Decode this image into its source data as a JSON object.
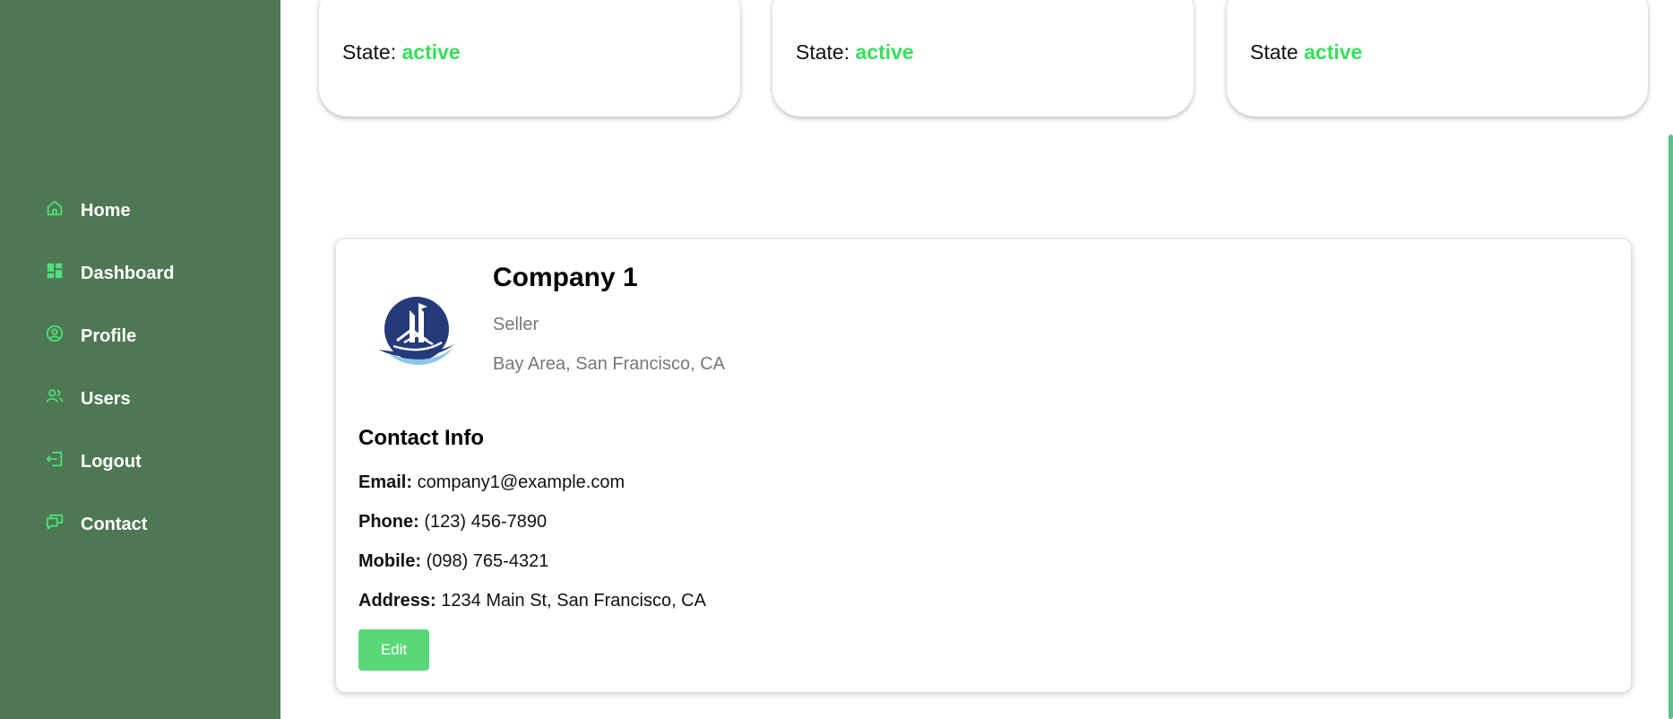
{
  "sidebar": {
    "items": [
      {
        "label": "Home",
        "icon": "home-icon"
      },
      {
        "label": "Dashboard",
        "icon": "dashboard-icon"
      },
      {
        "label": "Profile",
        "icon": "profile-icon"
      },
      {
        "label": "Users",
        "icon": "users-icon"
      },
      {
        "label": "Logout",
        "icon": "logout-icon"
      },
      {
        "label": "Contact",
        "icon": "contact-icon"
      }
    ]
  },
  "state_cards": [
    {
      "label": "State:",
      "value": "active"
    },
    {
      "label": "State:",
      "value": "active"
    },
    {
      "label": "State",
      "value": "active"
    }
  ],
  "company": {
    "name": "Company 1",
    "role": "Seller",
    "location": "Bay Area, San Francisco, CA",
    "contact_heading": "Contact Info",
    "email_label": "Email:",
    "email": "company1@example.com",
    "phone_label": "Phone:",
    "phone": "(123) 456-7890",
    "mobile_label": "Mobile:",
    "mobile": "(098) 765-4321",
    "address_label": "Address:",
    "address": "1234 Main St, San Francisco, CA",
    "edit_label": "Edit"
  },
  "colors": {
    "sidebar_bg": "#4e7753",
    "accent_green": "#36e05a",
    "button_green": "#59d878",
    "icon_green": "#4ee07a"
  }
}
